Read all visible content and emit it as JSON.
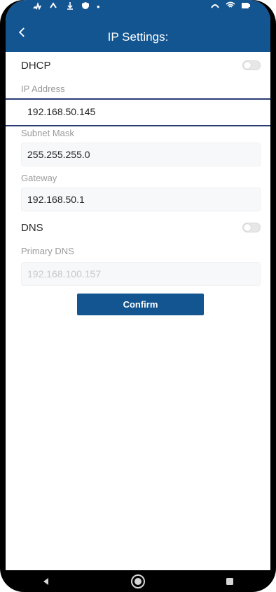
{
  "statusbar": {
    "left_icons": [
      "signal-icon",
      "transfer-icon",
      "download-icon",
      "shield-icon",
      "dot-icon"
    ],
    "right_icons": [
      "vpn-icon",
      "wifi-icon",
      "battery-icon"
    ]
  },
  "header": {
    "title": "IP Settings:",
    "back_icon": "chevron-left-icon",
    "color": "#135591"
  },
  "form": {
    "dhcp": {
      "label": "DHCP",
      "enabled": false
    },
    "ip_address": {
      "label": "IP Address",
      "value": "192.168.50.145"
    },
    "subnet_mask": {
      "label": "Subnet Mask",
      "value": "255.255.255.0"
    },
    "gateway": {
      "label": "Gateway",
      "value": "192.168.50.1"
    },
    "dns": {
      "label": "DNS",
      "enabled": false
    },
    "primary_dns": {
      "label": "Primary DNS",
      "value": "192.168.100.157",
      "disabled": true
    }
  },
  "actions": {
    "confirm_label": "Confirm"
  },
  "navbar": {
    "items": [
      "back-triangle-icon",
      "home-circle-icon",
      "recents-square-icon"
    ]
  }
}
